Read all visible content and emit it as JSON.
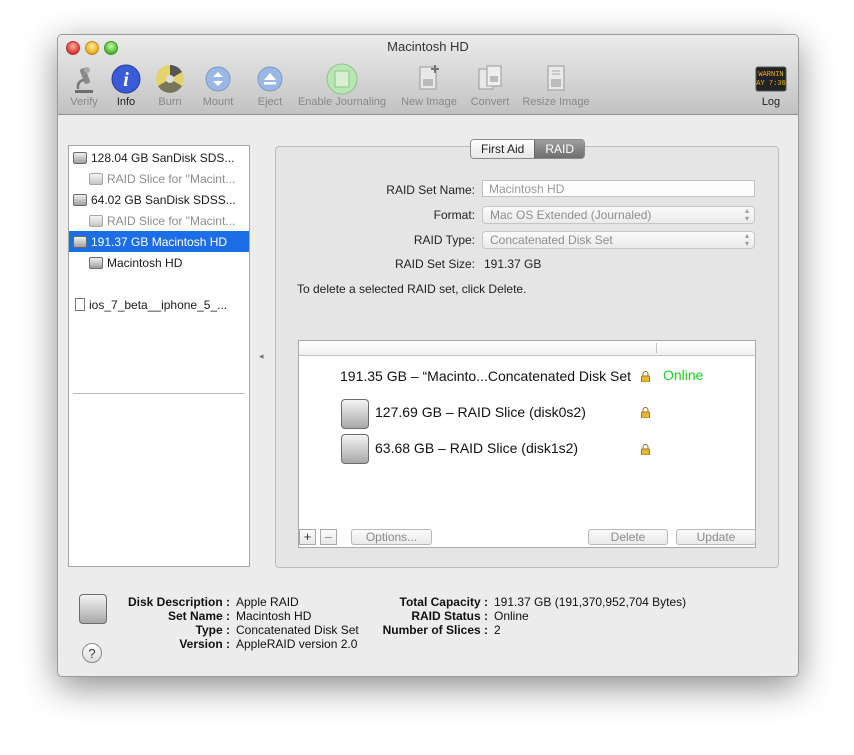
{
  "window": {
    "title": "Macintosh HD"
  },
  "toolbar": {
    "items": [
      {
        "label": "Verify",
        "icon": "microscope-icon"
      },
      {
        "label": "Info",
        "icon": "info-icon"
      },
      {
        "label": "Burn",
        "icon": "burn-icon"
      },
      {
        "label": "Mount",
        "icon": "mount-icon"
      },
      {
        "label": "Eject",
        "icon": "eject-icon"
      },
      {
        "label": "Enable Journaling",
        "icon": "journaling-icon"
      },
      {
        "label": "New Image",
        "icon": "new-image-icon"
      },
      {
        "label": "Convert",
        "icon": "convert-icon"
      },
      {
        "label": "Resize Image",
        "icon": "resize-image-icon"
      }
    ],
    "log": {
      "label": "Log",
      "icon_text_1": "WARNIN",
      "icon_text_2": "AY 7:36"
    }
  },
  "sidebar": {
    "items": [
      {
        "label": "128.04 GB SanDisk SDS..."
      },
      {
        "label": "RAID Slice for \"Macint..."
      },
      {
        "label": "64.02 GB SanDisk SDSS..."
      },
      {
        "label": "RAID Slice for \"Macint..."
      },
      {
        "label": "191.37 GB Macintosh HD"
      },
      {
        "label": "Macintosh HD"
      },
      {
        "label": "ios_7_beta__iphone_5_..."
      }
    ]
  },
  "tabs": {
    "first_aid": "First Aid",
    "raid": "RAID"
  },
  "raid": {
    "name_label": "RAID Set Name:",
    "name_value": "Macintosh HD",
    "format_label": "Format:",
    "format_value": "Mac OS Extended (Journaled)",
    "type_label": "RAID Type:",
    "type_value": "Concatenated Disk Set",
    "size_label": "RAID Set Size:",
    "size_value": "191.37 GB",
    "hint": "To delete a selected RAID set, click Delete.",
    "set_row": "191.35 GB – “Macinto...Concatenated Disk Set",
    "set_status": "Online",
    "slices": [
      {
        "label": "127.69 GB – RAID Slice (disk0s2)"
      },
      {
        "label": "63.68 GB – RAID Slice (disk1s2)"
      }
    ],
    "add": "+",
    "remove": "–",
    "options": "Options...",
    "delete": "Delete",
    "update": "Update"
  },
  "details": {
    "desc_label": "Disk Description :",
    "desc_value": "Apple RAID",
    "setname_label": "Set Name :",
    "setname_value": "Macintosh HD",
    "type_label": "Type :",
    "type_value": "Concatenated Disk Set",
    "version_label": "Version :",
    "version_value": "AppleRAID version 2.0",
    "capacity_label": "Total Capacity :",
    "capacity_value": "191.37 GB (191,370,952,704 Bytes)",
    "status_label": "RAID Status :",
    "status_value": "Online",
    "slices_label": "Number of Slices :",
    "slices_value": "2"
  },
  "help": "?",
  "colors": {
    "selection": "#1b6ee6",
    "online": "#22c72a",
    "info_blue": "#3b5bd6"
  }
}
